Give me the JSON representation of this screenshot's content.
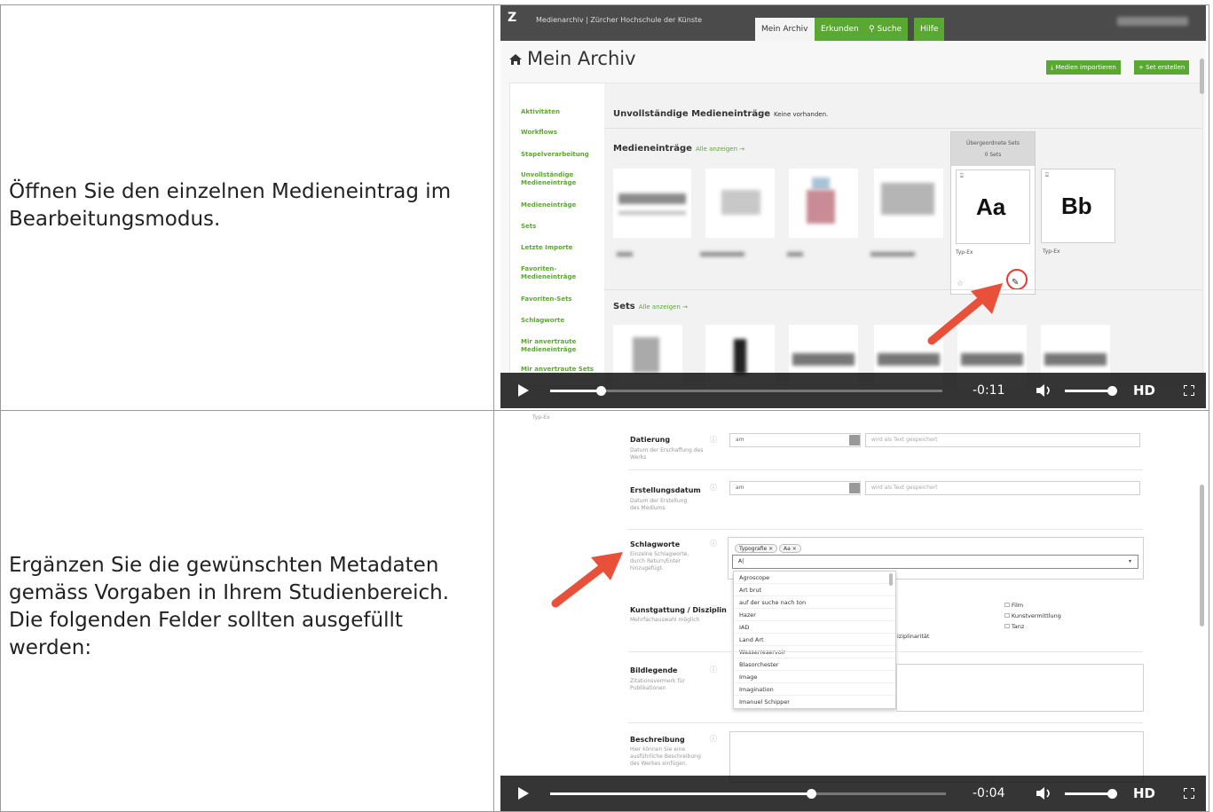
{
  "rows": [
    {
      "instruction": "Öffnen Sie den einzelnen Medieneintrag im Bearbeitungsmodus.",
      "screenshot": {
        "logo": "Z",
        "app_title": "Medienarchiv | Zürcher Hochschule der Künste",
        "tabs": [
          "Mein Archiv",
          "Erkunden",
          "Suche",
          "Hilfe"
        ],
        "page_title": "Mein Archiv",
        "buttons": [
          "Medien importieren",
          "Set erstellen"
        ],
        "sidebar": [
          "Aktivitäten",
          "Workflows",
          "Stapelverarbeitung",
          "Unvollständige Medieneinträge",
          "Medieneinträge",
          "Sets",
          "Letzte Importe",
          "Favoriten-Medieneinträge",
          "Favoriten-Sets",
          "Schlagworte",
          "Mir anvertraute Medieneinträge",
          "Mir anvertraute Sets"
        ],
        "incomplete_heading": "Unvollständige Medieneinträge",
        "incomplete_note": "Keine vorhanden.",
        "media_heading": "Medieneinträge",
        "show_all": "Alle anzeigen →",
        "hover_header": "Übergeordnete Sets",
        "hover_count": "0 Sets",
        "card_glyphs": [
          "Aa",
          "Bb"
        ],
        "card_labels": [
          "Typ-Ex",
          "Typ-Ex"
        ],
        "sets_heading": "Sets",
        "video": {
          "time": "-0:11",
          "hd": "HD",
          "progress": 0.13,
          "volume": 1.0
        }
      }
    },
    {
      "instruction": "Ergänzen Sie die gewünschten Metadaten gemäss Vorgaben in Ihrem Studienbereich. Die folgenden Felder sollten ausgefüllt werden:",
      "screenshot": {
        "top_cut_label": "Typ-Ex",
        "fields": [
          {
            "label": "Datierung",
            "help": "Datum der Erschaffung des Werks",
            "select": "am",
            "placeholder": "wird als Text gespeichert"
          },
          {
            "label": "Erstellungsdatum",
            "help": "Datum der Erstellung des Mediums",
            "select": "am",
            "placeholder": "wird als Text gespeichert"
          }
        ],
        "keywords": {
          "label": "Schlagworte",
          "help": "Einzelne Schlagworte, durch Return/Enter hinzugefügt.",
          "tags": [
            "Typografie ×",
            "Aa ×"
          ],
          "typed": "A|"
        },
        "dropdown_options": [
          "Agroscope",
          "Art brut",
          "auf der suche nach ton",
          "Hazer",
          "IAD",
          "Land Art",
          "Wasserreservoir",
          "Blasorchester",
          "Image",
          "Imagination",
          "Imanuel Schipper"
        ],
        "discipline": {
          "label": "Kunstgattung / Disziplin",
          "help": "Mehrfachauswahl möglich",
          "options_right": [
            "Film",
            "Kunstvermittlung",
            "Tanz"
          ],
          "partial_text": "iziplinarität"
        },
        "caption": {
          "label": "Bildlegende",
          "help": "Zitationsvermerk für Publikationen"
        },
        "description": {
          "label": "Beschreibung",
          "help": "Hier können Sie eine ausführliche Beschreibung des Werkes einfügen."
        },
        "video": {
          "time": "-0:04",
          "hd": "HD",
          "progress": 0.66,
          "volume": 1.0
        }
      }
    }
  ]
}
